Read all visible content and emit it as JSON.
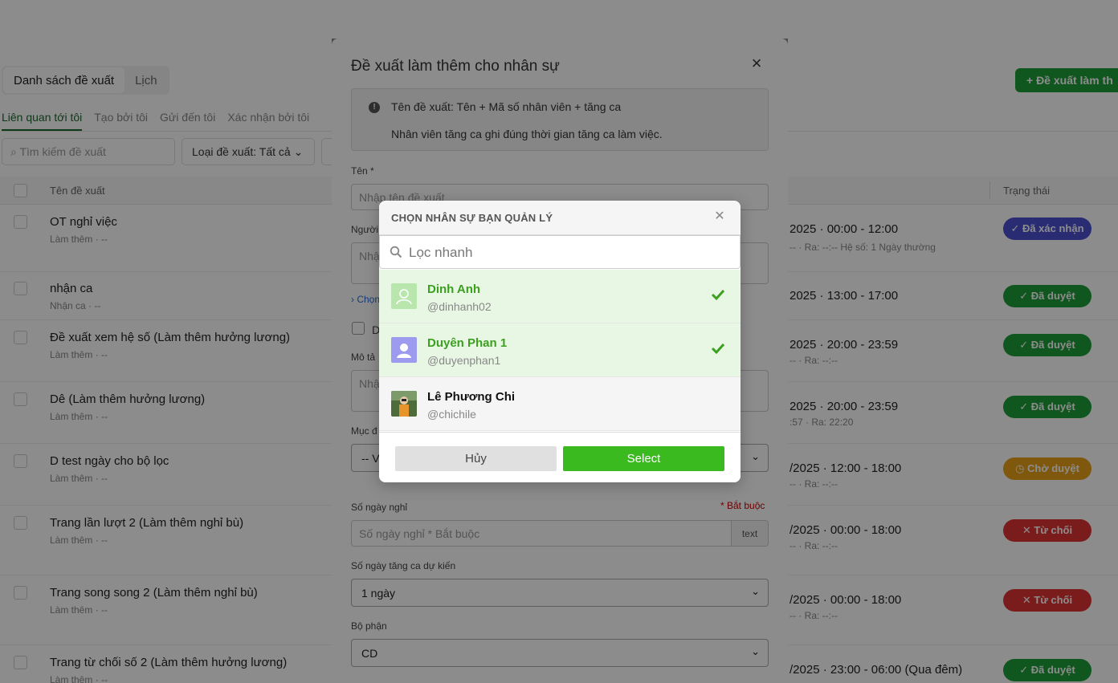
{
  "page": {
    "view_tabs": [
      "Danh sách đề xuất",
      "Lịch"
    ],
    "new_button_label": "+ Đề xuất làm th",
    "filter_tabs": [
      "Liên quan tới tôi",
      "Tạo bởi tôi",
      "Gửi đến tôi",
      "Xác nhận bởi tôi"
    ],
    "search_placeholder": "Tìm kiếm đề xuất",
    "type_filter": "Loại đề xuất: Tất cả",
    "columns": {
      "name": "Tên đề xuất",
      "status": "Trạng thái"
    },
    "rows": [
      {
        "title": "OT nghỉ việc",
        "sub": "Làm thêm · --",
        "time": "2025 · 00:00 - 12:00",
        "meta": "-- · Ra: --:--   Hệ số: 1   Ngày thường",
        "status": "Đã xác nhận"
      },
      {
        "title": "nhận ca",
        "sub": "Nhận ca · --",
        "time": "2025 · 13:00 - 17:00",
        "meta": "",
        "status": "Đã duyệt"
      },
      {
        "title": "Đề xuất xem hệ số (Làm thêm hưởng lương)",
        "sub": "Làm thêm · --",
        "time": "2025 · 20:00 - 23:59",
        "meta": "-- · Ra: --:--",
        "status": "Đã duyệt"
      },
      {
        "title": "Dê (Làm thêm hưởng lương)",
        "sub": "Làm thêm · --",
        "time": "2025 · 20:00 - 23:59",
        "meta": ":57 · Ra: 22:20",
        "status": "Đã duyệt"
      },
      {
        "title": "D test ngày cho bộ lọc",
        "sub": "Làm thêm · --",
        "time": "/2025 · 12:00 - 18:00",
        "meta": "-- · Ra: --:--",
        "status": "Chờ duyệt"
      },
      {
        "title": "Trang lần lượt 2 (Làm thêm nghỉ bù)",
        "sub": "Làm thêm · --",
        "time": "/2025 · 00:00 - 18:00",
        "meta": "-- · Ra: --:--",
        "status": "Từ chối"
      },
      {
        "title": "Trang song song 2 (Làm thêm nghỉ bù)",
        "sub": "Làm thêm · --",
        "time": "/2025 · 00:00 - 18:00",
        "meta": "-- · Ra: --:--",
        "status": "Từ chối"
      },
      {
        "title": "Trang từ chối số 2 (Làm thêm hưởng lương)",
        "sub": "Làm thêm · --",
        "time": "/2025 · 23:00 - 06:00 (Qua đêm)",
        "meta": "",
        "status": "Đã duyệt"
      }
    ]
  },
  "modal": {
    "title": "Đề xuất làm thêm cho nhân sự",
    "info_line1": "Tên đề xuất: Tên + Mã số nhân viên + tăng ca",
    "info_line2": "Nhân viên tăng ca ghi đúng thời gian tăng ca làm việc.",
    "name_label": "Tên *",
    "name_placeholder": "Nhập tên đề xuất",
    "person_label": "Người",
    "person_placeholder": "Nhậ",
    "choose_link": "› Chọn",
    "checkbox_label": "D",
    "desc_label": "Mô tả",
    "desc_placeholder": "Nhậ",
    "purpose_label": "Mục đ",
    "purpose_value": "-- V",
    "days_off_label": "Số ngày nghỉ",
    "days_off_required": "* Bắt buộc",
    "days_off_placeholder": "Số ngày nghỉ * Bắt buộc",
    "days_off_addon": "text",
    "ot_days_label": "Số ngày tăng ca dự kiến",
    "ot_days_value": "1 ngày",
    "dept_label": "Bộ phận",
    "dept_value": "CD"
  },
  "picker": {
    "title": "CHỌN NHÂN SỰ BẠN QUẢN LÝ",
    "search_placeholder": "Lọc nhanh",
    "items": [
      {
        "name": "Dinh Anh",
        "handle": "@dinhanh02",
        "selected": true
      },
      {
        "name": "Duyên Phan 1",
        "handle": "@duyenphan1",
        "selected": true
      },
      {
        "name": "Lê Phương Chi",
        "handle": "@chichile",
        "selected": false
      }
    ],
    "cancel_label": "Hủy",
    "select_label": "Select"
  },
  "colors": {
    "accent_green": "#3aba1e",
    "approved": "#1e9e3a",
    "confirmed": "#4b4fd1",
    "pending": "#e8a11a",
    "rejected": "#e03434"
  },
  "icons": [
    "search-icon",
    "chevron-down-icon",
    "close-icon",
    "info-icon",
    "check-icon",
    "user-avatar-icon"
  ]
}
